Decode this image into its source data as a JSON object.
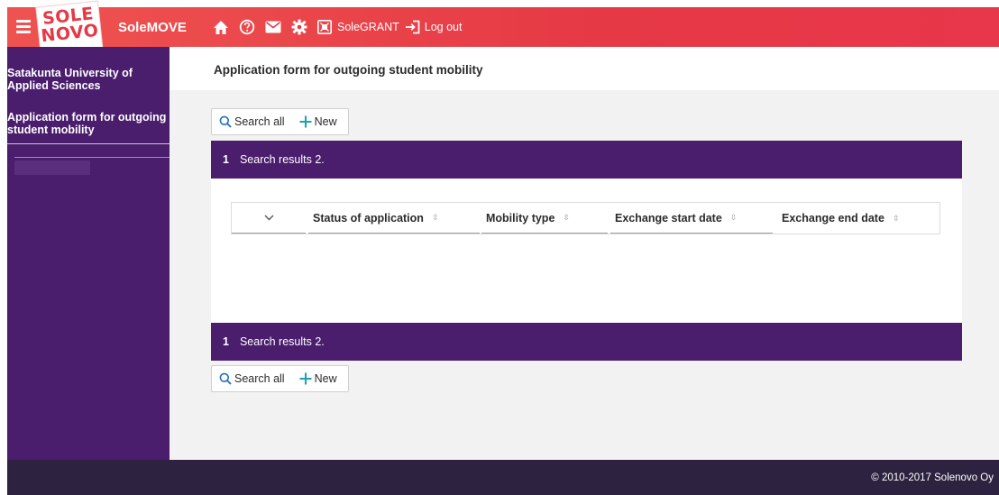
{
  "header": {
    "logo_line1": "SOLE",
    "logo_line2": "NOVO",
    "app_name": "SoleMOVE",
    "icons": [
      "menu-icon",
      "home-icon",
      "help-icon",
      "mail-icon",
      "gear-icon",
      "grant-icon",
      "logout-icon"
    ],
    "solegrant_label": "SoleGRANT",
    "logout_label": "Log out",
    "accent_color": "#e53945"
  },
  "sidebar": {
    "organization": "Satakunta University of Applied Sciences",
    "items": [
      {
        "label": "Application form for outgoing student mobility"
      }
    ],
    "background": "#4a1d6d"
  },
  "main": {
    "page_title": "Application form for outgoing student mobility",
    "toolbar": {
      "search_all_label": "Search all",
      "new_label": "New"
    },
    "results": {
      "page_number": "1",
      "label": "Search results 2."
    },
    "table": {
      "columns": [
        {
          "label": "Status of application"
        },
        {
          "label": "Mobility type"
        },
        {
          "label": "Exchange start date"
        },
        {
          "label": "Exchange end date"
        }
      ],
      "rows": []
    }
  },
  "footer": {
    "copyright": "© 2010-2017  Solenovo Oy"
  }
}
